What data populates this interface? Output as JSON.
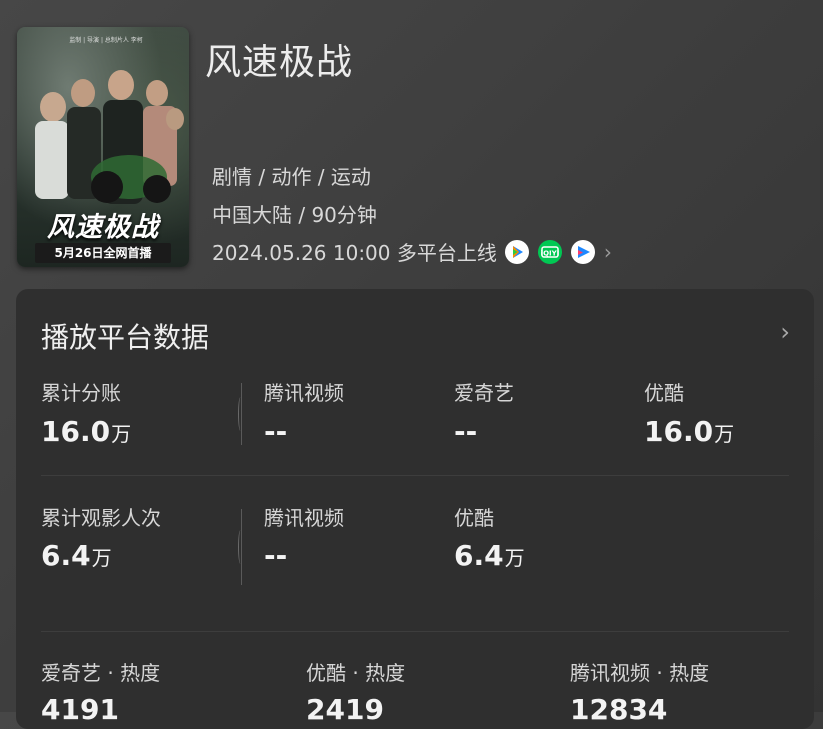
{
  "movie": {
    "title": "风速极战",
    "genres": "剧情 / 动作 / 运动",
    "region_duration": "中国大陆 / 90分钟",
    "release": "2024.05.26 10:00 多平台上线",
    "platform_icons": [
      "tencent-video-icon",
      "iqiyi-icon",
      "youku-icon"
    ]
  },
  "poster": {
    "title_text": "风速极战",
    "date_text": "5月26日全网首播",
    "credit_text": "监制 | 导演 | 总制片人 李柯"
  },
  "card": {
    "title": "播放平台数据",
    "revenue": {
      "label": "累计分账",
      "value": "16.0",
      "unit": "万",
      "platforms": [
        {
          "label": "腾讯视频",
          "value": "--",
          "unit": ""
        },
        {
          "label": "爱奇艺",
          "value": "--",
          "unit": ""
        },
        {
          "label": "优酷",
          "value": "16.0",
          "unit": "万"
        }
      ]
    },
    "views": {
      "label": "累计观影人次",
      "value": "6.4",
      "unit": "万",
      "platforms": [
        {
          "label": "腾讯视频",
          "value": "--",
          "unit": ""
        },
        {
          "label": "优酷",
          "value": "6.4",
          "unit": "万"
        }
      ]
    },
    "heat": [
      {
        "label": "爱奇艺 · 热度",
        "value": "4191"
      },
      {
        "label": "优酷 · 热度",
        "value": "2419"
      },
      {
        "label": "腾讯视频 · 热度",
        "value": "12834"
      }
    ]
  },
  "colors": {
    "background": "#3e3e3e",
    "card": "#2f2f2f",
    "iqiyi_green": "#00c853",
    "youku_blue": "#1e88ff",
    "tencent_orange": "#ff8a00"
  }
}
